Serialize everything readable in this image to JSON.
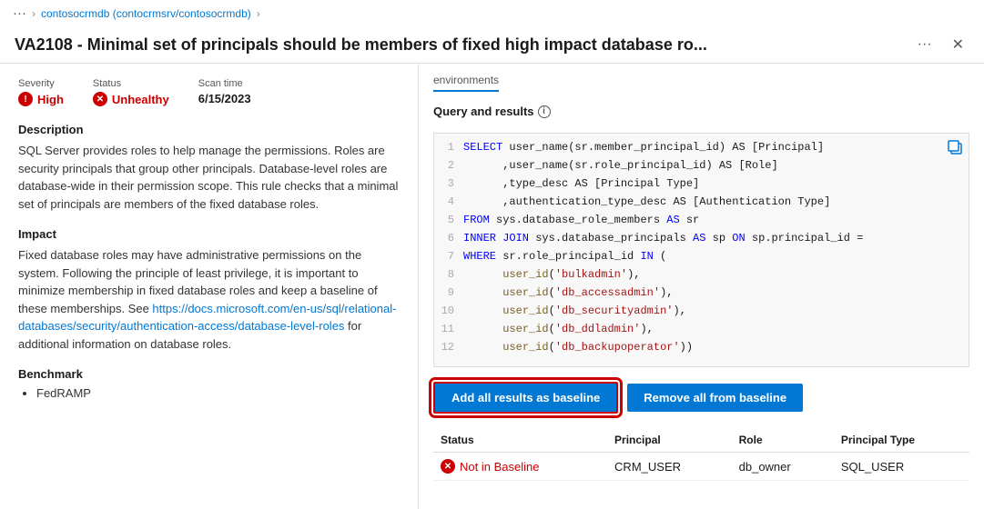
{
  "topbar": {
    "ellipsis": "...",
    "breadcrumb1": "contosocrmdb (contocrmsrv/contosocrmdb)",
    "separator": ">",
    "more_icon": "›"
  },
  "header": {
    "title": "VA2108 - Minimal set of principals should be members of fixed high impact database ro...",
    "more_label": "···",
    "close_label": "✕"
  },
  "left": {
    "severity_label": "Severity",
    "severity_value": "High",
    "status_label": "Status",
    "status_value": "Unhealthy",
    "scan_time_label": "Scan time",
    "scan_time_value": "6/15/2023",
    "description_title": "Description",
    "description_body": "SQL Server provides roles to help manage the permissions. Roles are security principals that group other principals. Database-level roles are database-wide in their permission scope. This rule checks that a minimal set of principals are members of the fixed database roles.",
    "impact_title": "Impact",
    "impact_body1": "Fixed database roles may have administrative permissions on the system. Following the principle of least privilege, it is important to minimize membership in fixed database roles and keep a baseline of these memberships. See ",
    "impact_link": "https://docs.microsoft.com/en-us/sql/relational-databases/security/authentication-access/database-level-roles",
    "impact_body2": " for additional information on database roles.",
    "benchmark_title": "Benchmark",
    "benchmark_items": [
      "FedRAMP"
    ]
  },
  "right": {
    "env_tab": "environments",
    "query_title": "Query and results",
    "code_lines": [
      {
        "num": "1",
        "content": "SELECT user_name(sr.member_principal_id) AS [Principal]"
      },
      {
        "num": "2",
        "content": "      ,user_name(sr.role_principal_id) AS [Role]"
      },
      {
        "num": "3",
        "content": "      ,type_desc AS [Principal Type]"
      },
      {
        "num": "4",
        "content": "      ,authentication_type_desc AS [Authentication Type]"
      },
      {
        "num": "5",
        "content": "FROM sys.database_role_members AS sr"
      },
      {
        "num": "6",
        "content": "INNER JOIN sys.database_principals AS sp ON sp.principal_id ="
      },
      {
        "num": "7",
        "content": "WHERE sr.role_principal_id IN ("
      },
      {
        "num": "8",
        "content": "      user_id('bulkadmin'),"
      },
      {
        "num": "9",
        "content": "      user_id('db_accessadmin'),"
      },
      {
        "num": "10",
        "content": "      user_id('db_securityadmin'),"
      },
      {
        "num": "11",
        "content": "      user_id('db_ddladmin'),"
      },
      {
        "num": "12",
        "content": "      user_id('db_backupoperator'))"
      }
    ],
    "add_baseline_btn": "Add all results as baseline",
    "remove_baseline_btn": "Remove all from baseline",
    "table_headers": [
      "Status",
      "Principal",
      "Role",
      "Principal Type"
    ],
    "table_rows": [
      {
        "status": "Not in Baseline",
        "principal": "CRM_USER",
        "role": "db_owner",
        "principal_type": "SQL_USER"
      }
    ]
  },
  "colors": {
    "accent": "#0078d4",
    "danger": "#c00000",
    "code_kw": "#0000ff",
    "code_fn": "#795e26",
    "code_str": "#a31515"
  }
}
